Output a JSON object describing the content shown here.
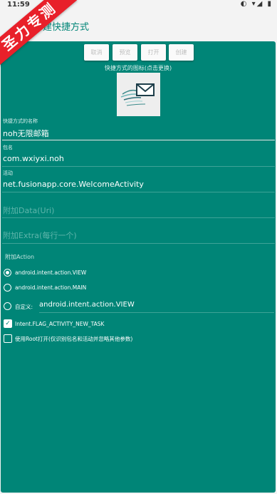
{
  "status": {
    "time": "11:59"
  },
  "watermark": {
    "text": "圣力专测"
  },
  "appbar": {
    "title": "建快捷方式"
  },
  "buttons": [
    "取消",
    "预览",
    "打开",
    "创建"
  ],
  "icon_hint": "快捷方式的图标(点击更换)",
  "fields": {
    "name_label": "快捷方式的名称",
    "name_value": "noh无限邮箱",
    "package_label": "包名",
    "package_value": "com.wxiyxi.noh",
    "activity_label": "活动",
    "activity_value": "net.fusionapp.core.WelcomeActivity",
    "data_placeholder": "附加Data(Uri)",
    "extra_placeholder": "附加Extra(每行一个)"
  },
  "action_section": {
    "label": "附加Action",
    "options": [
      {
        "label": "android.intent.action.VIEW",
        "selected": true
      },
      {
        "label": "android.intent.action.MAIN",
        "selected": false
      },
      {
        "label": "自定义:",
        "custom_value": "android.intent.action.VIEW",
        "selected": false
      }
    ]
  },
  "flags": [
    {
      "label": "Intent.FLAG_ACTIVITY_NEW_TASK",
      "checked": true
    },
    {
      "label": "使用Root打开(仅识别包名和活动并忽略其他参数)",
      "checked": false
    }
  ],
  "colors": {
    "accent": "#008577",
    "watermark": "#e8202a"
  }
}
